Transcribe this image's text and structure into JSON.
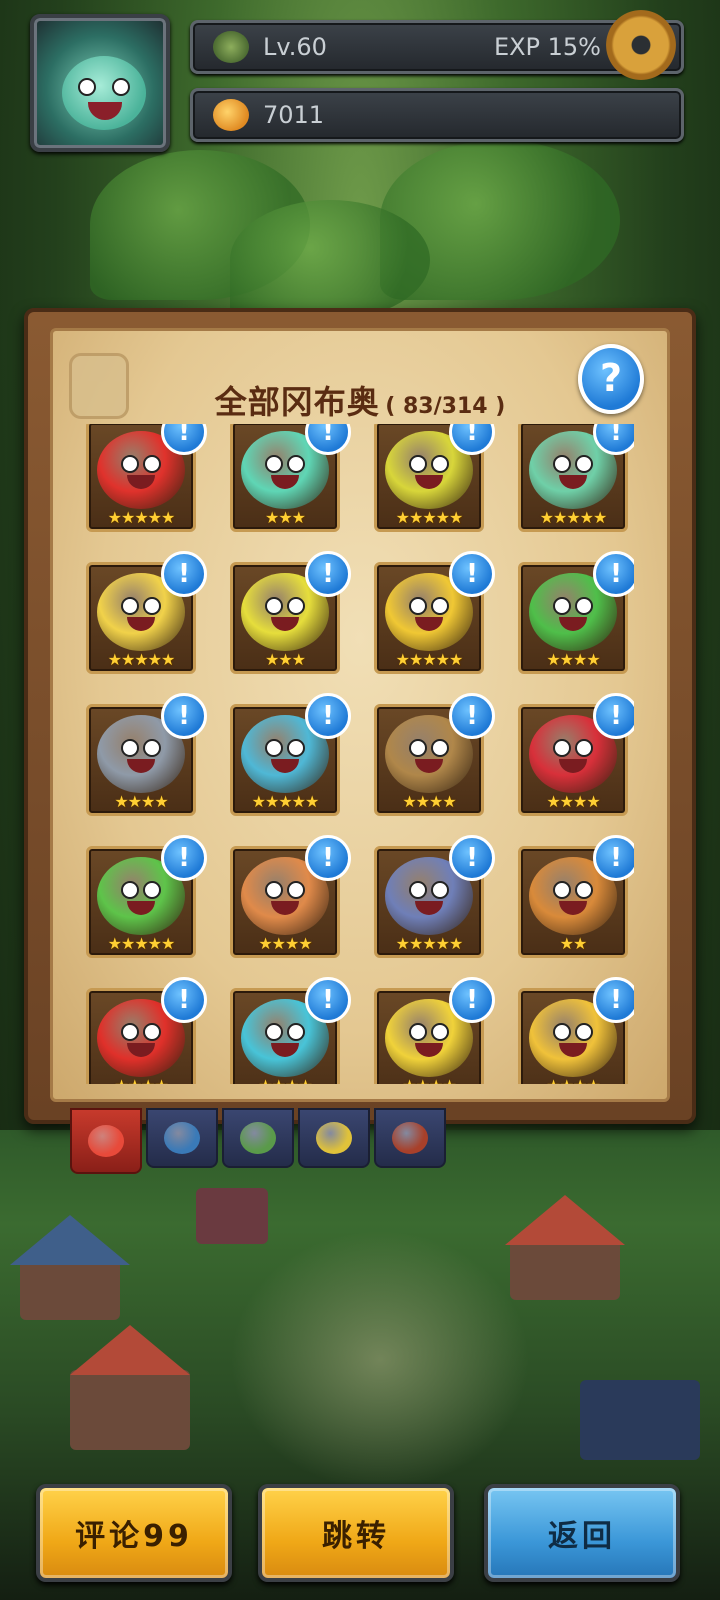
{
  "hud": {
    "level": "Lv.60",
    "exp": "EXP 15%",
    "coins": "7011"
  },
  "panel": {
    "title": "全部冈布奥",
    "count": "( 83/314 )",
    "help_label": "?"
  },
  "cards": [
    {
      "stars": "★★★★★",
      "color": "#e0322c",
      "badge": "!"
    },
    {
      "stars": "★★★",
      "color": "#5fd6b5",
      "badge": "!"
    },
    {
      "stars": "★★★★★",
      "color": "#d8d63a",
      "badge": "!"
    },
    {
      "stars": "★★★★★",
      "color": "#6fd0a8",
      "badge": "!"
    },
    {
      "stars": "★★★★★",
      "color": "#f1d24a",
      "badge": "!"
    },
    {
      "stars": "★★★",
      "color": "#e6de3c",
      "badge": "!"
    },
    {
      "stars": "★★★★★",
      "color": "#f0c834",
      "badge": "!"
    },
    {
      "stars": "★★★★",
      "color": "#4fbf4a",
      "badge": "!"
    },
    {
      "stars": "★★★★",
      "color": "#8f9aa8",
      "badge": "!"
    },
    {
      "stars": "★★★★★",
      "color": "#4fb8d6",
      "badge": "!"
    },
    {
      "stars": "★★★★",
      "color": "#b0874a",
      "badge": "!"
    },
    {
      "stars": "★★★★",
      "color": "#d8303a",
      "badge": "!"
    },
    {
      "stars": "★★★★★",
      "color": "#5ec44a",
      "badge": "!"
    },
    {
      "stars": "★★★★",
      "color": "#e08a4a",
      "badge": "!"
    },
    {
      "stars": "★★★★★",
      "color": "#6f7fb8",
      "badge": "!"
    },
    {
      "stars": "★★",
      "color": "#d98a3a",
      "badge": "!"
    },
    {
      "stars": "★★★★",
      "color": "#e0302a",
      "badge": "!"
    },
    {
      "stars": "★★★★",
      "color": "#48c4d8",
      "badge": "!"
    },
    {
      "stars": "★★★★",
      "color": "#f0d23a",
      "badge": "!"
    },
    {
      "stars": "★★★★",
      "color": "#f0c23a",
      "badge": "!"
    }
  ],
  "tabs": [
    {
      "name": "all",
      "color": "#e84a3a",
      "active": true
    },
    {
      "name": "blue",
      "color": "#3a7ab8",
      "active": false
    },
    {
      "name": "green",
      "color": "#5a9a4a",
      "active": false
    },
    {
      "name": "yellow",
      "color": "#e0c23a",
      "active": false
    },
    {
      "name": "red",
      "color": "#a8402a",
      "active": false
    }
  ],
  "buttons": {
    "review": "评论99",
    "jump": "跳转",
    "back": "返回"
  },
  "colors": {
    "yellow_button": "#f0a817",
    "blue_button": "#3b97d8",
    "badge_blue": "#1f7ad6",
    "star_gold": "#ffcf33"
  }
}
